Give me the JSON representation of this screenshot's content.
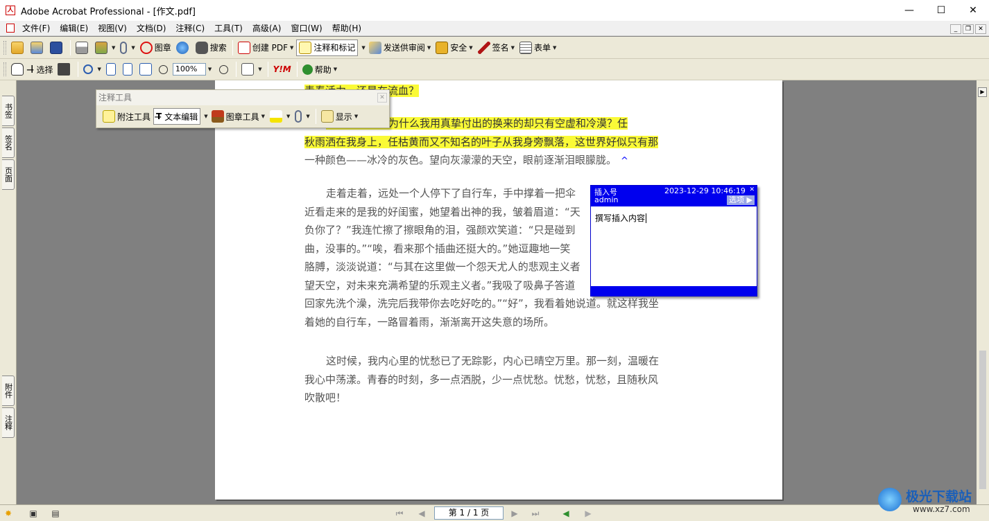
{
  "window": {
    "title": "Adobe Acrobat Professional - [作文.pdf]",
    "min": "—",
    "max": "☐",
    "close": "✕"
  },
  "menu": [
    "文件(F)",
    "编辑(E)",
    "视图(V)",
    "文档(D)",
    "注释(C)",
    "工具(T)",
    "高级(A)",
    "窗口(W)",
    "帮助(H)"
  ],
  "toolbar1": {
    "stamp": "图章",
    "search": "搜索",
    "create_pdf": "创建 PDF",
    "comment_markup": "注释和标记",
    "send_review": "发送供审阅",
    "security": "安全",
    "sign": "签名",
    "forms": "表单"
  },
  "toolbar2": {
    "select": "选择",
    "zoom_value": "100%",
    "help": "帮助"
  },
  "left_tabs": [
    "书签",
    "签名",
    "页面",
    "附件",
    "注释"
  ],
  "comment_toolbar": {
    "title": "注释工具",
    "note_tool": "附注工具",
    "text_edit": "文本编辑",
    "stamp_tool": "图章工具",
    "show": "显示"
  },
  "document": {
    "line0": "青春活力，还是在流血？",
    "p1": [
      "我睁开眼眸，为什么我用真挚付出的换来的却只有空虚和冷漠？任",
      "秋雨洒在我身上，任枯黄而又不知名的叶子从我身旁飘落，这世界好似只有那",
      "一种颜色——冰冷的灰色。望向灰濛濛的天空，眼前逐渐泪眼朦胧。"
    ],
    "p2": [
      "走着走着，远处一个人停下了自行车，手中撑着一把伞",
      "近看走来的是我的好闺蜜，她望着出神的我，皱着眉道：“天",
      "负你了？”我连忙擦了擦眼角的泪，强颜欢笑道：“只是碰到",
      "曲，没事的。”“唉，看来那个插曲还挺大的。”她逗趣地一笑",
      "胳膊，淡淡说道：“与其在这里做一个怨天尤人的悲观主义者",
      "望天空，对未来充满希望的乐观主义者。”我吸了吸鼻子答道",
      "回家先洗个澡，洗完后我带你去吃好吃的。”“好”，我看着她说道。就这样我坐",
      "着她的自行车，一路冒着雨，渐渐离开这失意的场所。"
    ],
    "p3": [
      "这时候，我内心里的忧愁已了无踪影，内心已晴空万里。那一刻，温暖在",
      "我心中荡漾。青春的时刻，多一点洒脱，少一点忧愁。忧愁，忧愁，且随秋风",
      "吹散吧！"
    ],
    "caret": "^"
  },
  "note": {
    "type": "插入号",
    "author": "admin",
    "date": "2023-12-29 10:46:19",
    "options": "选项",
    "text": "撰写插入内容"
  },
  "statusbar": {
    "page": "第 1 / 1 页"
  },
  "watermark": {
    "site": "极光下载站",
    "url": "www.xz7.com"
  },
  "colors": {
    "highlight": "#fafa37",
    "note_blue": "#0000ee",
    "chrome": "#ece9d8"
  }
}
